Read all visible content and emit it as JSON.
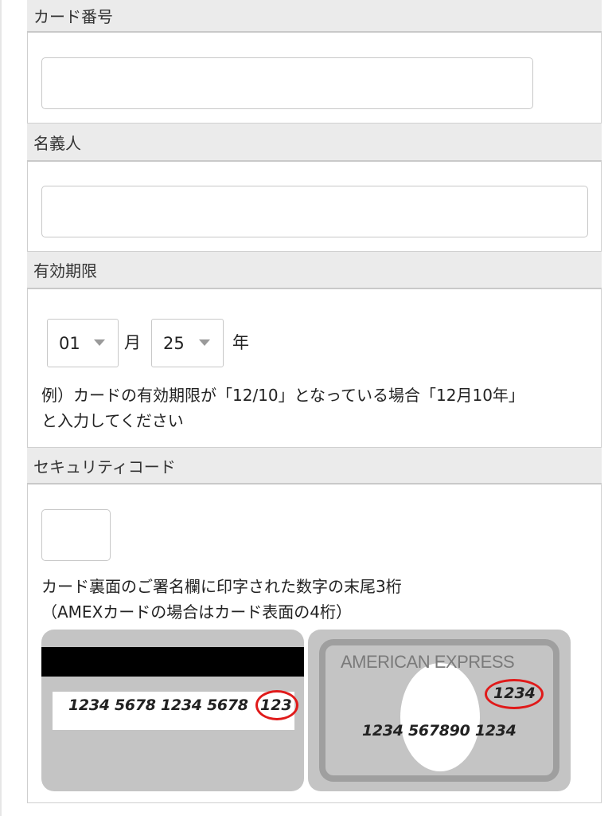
{
  "sections": {
    "card_number": {
      "title": "カード番号",
      "value": "",
      "placeholder": ""
    },
    "holder": {
      "title": "名義人",
      "value": "",
      "placeholder": ""
    },
    "expiry": {
      "title": "有効期限",
      "month_value": "01",
      "month_unit": "月",
      "year_value": "25",
      "year_unit": "年",
      "note_line1": "例）カードの有効期限が「12/10」となっている場合「12月10年」",
      "note_line2": "と入力してください"
    },
    "security": {
      "title": "セキュリティコード",
      "value": "",
      "note_line1": "カード裏面のご署名欄に印字された数字の末尾3桁",
      "note_line2": "（AMEXカードの場合はカード表面の4桁）"
    }
  },
  "card_back": {
    "number": "1234 5678 1234 5678",
    "code": "123"
  },
  "card_front": {
    "brand": "AMERICAN EXPRESS",
    "code": "1234",
    "number": "1234 567890 1234"
  },
  "colors": {
    "highlight_circle": "#e01a1a",
    "card_gray": "#c4c4c4",
    "header_bg": "#ebebeb"
  }
}
